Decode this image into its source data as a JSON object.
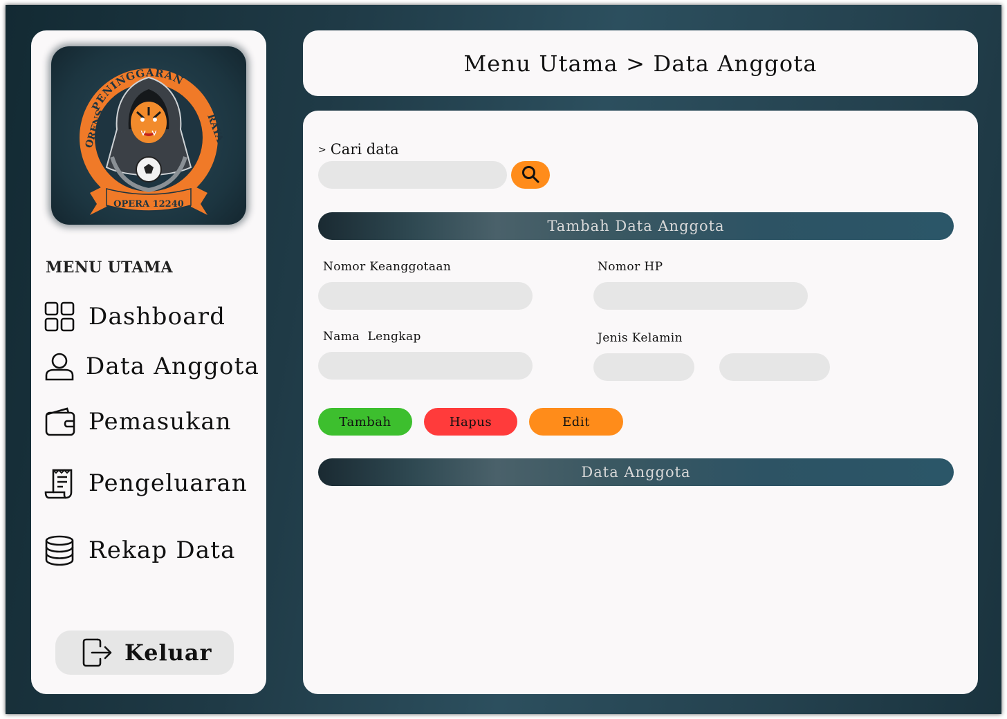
{
  "logo": {
    "top_arc_text": "PENINGGARAN",
    "left_text": "ORENS",
    "right_text": "RAYA",
    "banner_text": "OPERA 12240"
  },
  "sidebar": {
    "menu_heading": "MENU UTAMA",
    "items": [
      {
        "label": "Dashboard",
        "icon": "dashboard-grid-icon"
      },
      {
        "label": "Data Anggota",
        "icon": "user-icon"
      },
      {
        "label": "Pemasukan",
        "icon": "wallet-icon"
      },
      {
        "label": "Pengeluaran",
        "icon": "receipt-icon"
      },
      {
        "label": "Rekap Data",
        "icon": "database-icon"
      }
    ],
    "logout_label": "Keluar",
    "logout_icon": "logout-icon"
  },
  "header": {
    "breadcrumb": "Menu Utama > Data Anggota"
  },
  "search": {
    "label": "Cari data",
    "value": "",
    "icon": "search-icon"
  },
  "form": {
    "section_title": "Tambah Data Anggota",
    "fields": {
      "nomor_keanggotaan": {
        "label": "Nomor Keanggotaan",
        "value": ""
      },
      "nomor_hp": {
        "label": "Nomor HP",
        "value": ""
      },
      "nama_lengkap": {
        "label": "Nama  Lengkap",
        "value": ""
      },
      "jenis_kelamin": {
        "label": "Jenis Kelamin",
        "options_visible": [
          "",
          ""
        ]
      }
    },
    "buttons": {
      "tambah": "Tambah",
      "hapus": "Hapus",
      "edit": "Edit"
    }
  },
  "table_section": {
    "title": "Data Anggota"
  },
  "colors": {
    "accent_orange": "#ff8c1a",
    "add_green": "#3dbf2e",
    "delete_red": "#ff3b3b",
    "panel_bg": "#faf8f9",
    "field_bg": "#e6e6e6"
  }
}
